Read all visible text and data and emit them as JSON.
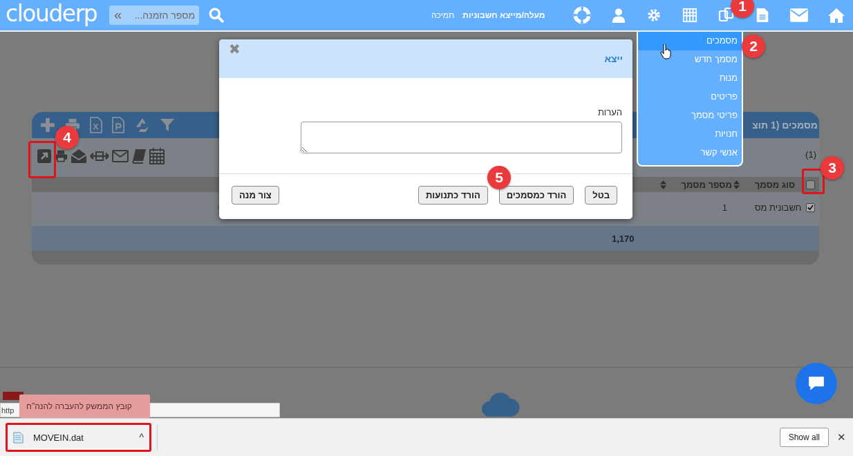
{
  "header": {
    "logo": "clouderp",
    "search": {
      "placeholder": "מספר הזמנה...",
      "chevron": "«"
    },
    "links": [
      {
        "label": "מעלה/מייצא חשבוניות",
        "bold": true
      },
      {
        "label": "תמיכה",
        "bold": false
      }
    ]
  },
  "menu": {
    "items": [
      {
        "label": "מסמכים",
        "selected": true
      },
      {
        "label": "מסמך חדש",
        "selected": false
      },
      {
        "label": "מנות",
        "selected": false
      },
      {
        "label": "פריטים",
        "selected": false
      },
      {
        "label": "פריטי מסמך",
        "selected": false
      },
      {
        "label": "חנויות",
        "selected": false
      },
      {
        "label": "אנשי קשר",
        "selected": false
      }
    ]
  },
  "panel": {
    "title": "מסמכים (1 תוצ",
    "count": "(1)",
    "select_all": {
      "checked": false
    },
    "columns": [
      "סוג מסמך",
      "מספר מסמך"
    ],
    "rows": [
      {
        "checked": true,
        "type": "חשבונית מס",
        "number": "1"
      }
    ],
    "total": "1,170"
  },
  "dialog": {
    "title": "ייצא",
    "close": "✖",
    "field_label": "הערות",
    "buttons": [
      "בטל",
      "הורד כמסמכים",
      "הורד כתנועות"
    ],
    "secondary_button": "צור מנה"
  },
  "callouts": [
    "1",
    "2",
    "3",
    "4",
    "5"
  ],
  "downloads": {
    "status_url": "http",
    "tooltip": "קובץ הממשק להעברה להנה\"ח",
    "file": "MOVEIN.dat",
    "caret": "^",
    "show_all": "Show all",
    "close": "✕"
  }
}
